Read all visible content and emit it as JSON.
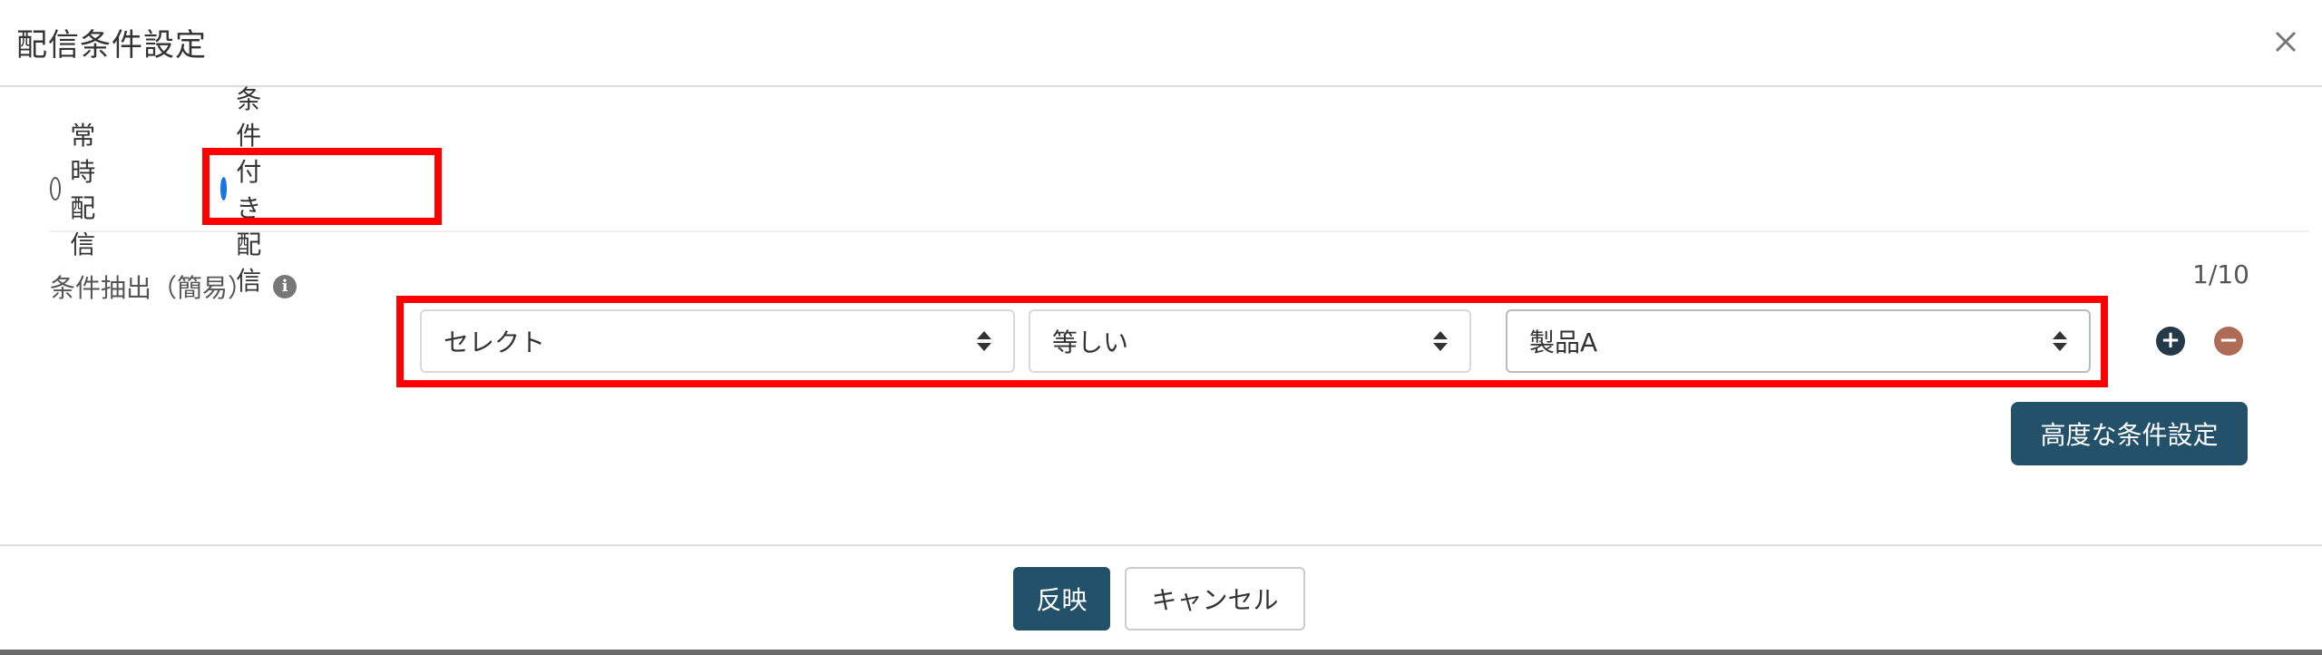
{
  "dialog": {
    "title": "配信条件設定",
    "close_icon": "close-icon"
  },
  "delivery_mode": {
    "options": [
      {
        "label": "常時配信",
        "checked": false
      },
      {
        "label": "条件付き配信",
        "checked": true
      }
    ]
  },
  "condition": {
    "label": "条件抽出（簡易）",
    "info_icon": "info-icon",
    "counter": "1/10",
    "field": "セレクト",
    "operator": "等しい",
    "value": "製品A",
    "add_icon": "plus-circle-icon",
    "remove_icon": "minus-circle-icon",
    "advanced_button": "高度な条件設定"
  },
  "footer": {
    "apply_label": "反映",
    "cancel_label": "キャンセル"
  },
  "colors": {
    "primary": "#24516a",
    "radio_accent": "#1a73e8",
    "highlight": "#ff0000",
    "remove_button": "#b06b57",
    "add_button": "#243a4a"
  }
}
